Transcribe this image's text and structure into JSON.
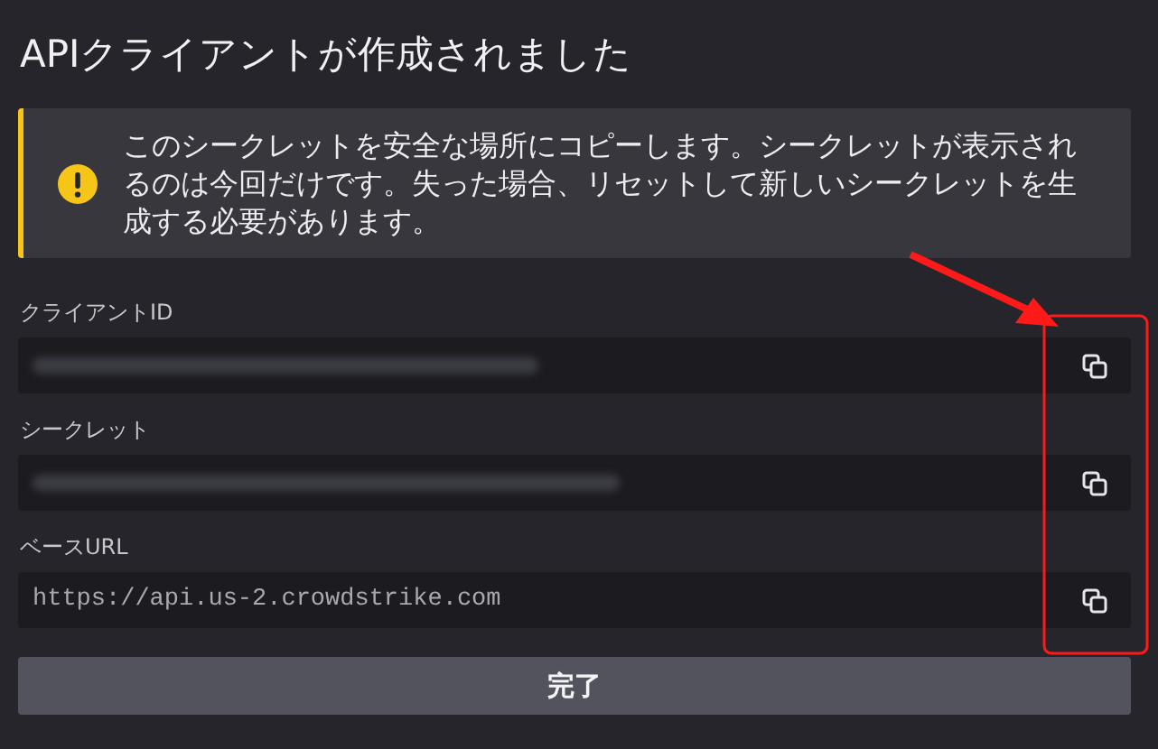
{
  "title": "APIクライアントが作成されました",
  "alert": {
    "message": "このシークレットを安全な場所にコピーします。シークレットが表示されるのは今回だけです。失った場合、リセットして新しいシークレットを生成する必要があります。"
  },
  "fields": [
    {
      "label": "クライアントID",
      "kind": "blurred"
    },
    {
      "label": "シークレット",
      "kind": "blurred"
    },
    {
      "label": "ベースURL",
      "kind": "text",
      "value": "https://api.us-2.crowdstrike.com"
    }
  ],
  "done_button": "完了",
  "annotation": {
    "arrow": true,
    "frame": true
  }
}
